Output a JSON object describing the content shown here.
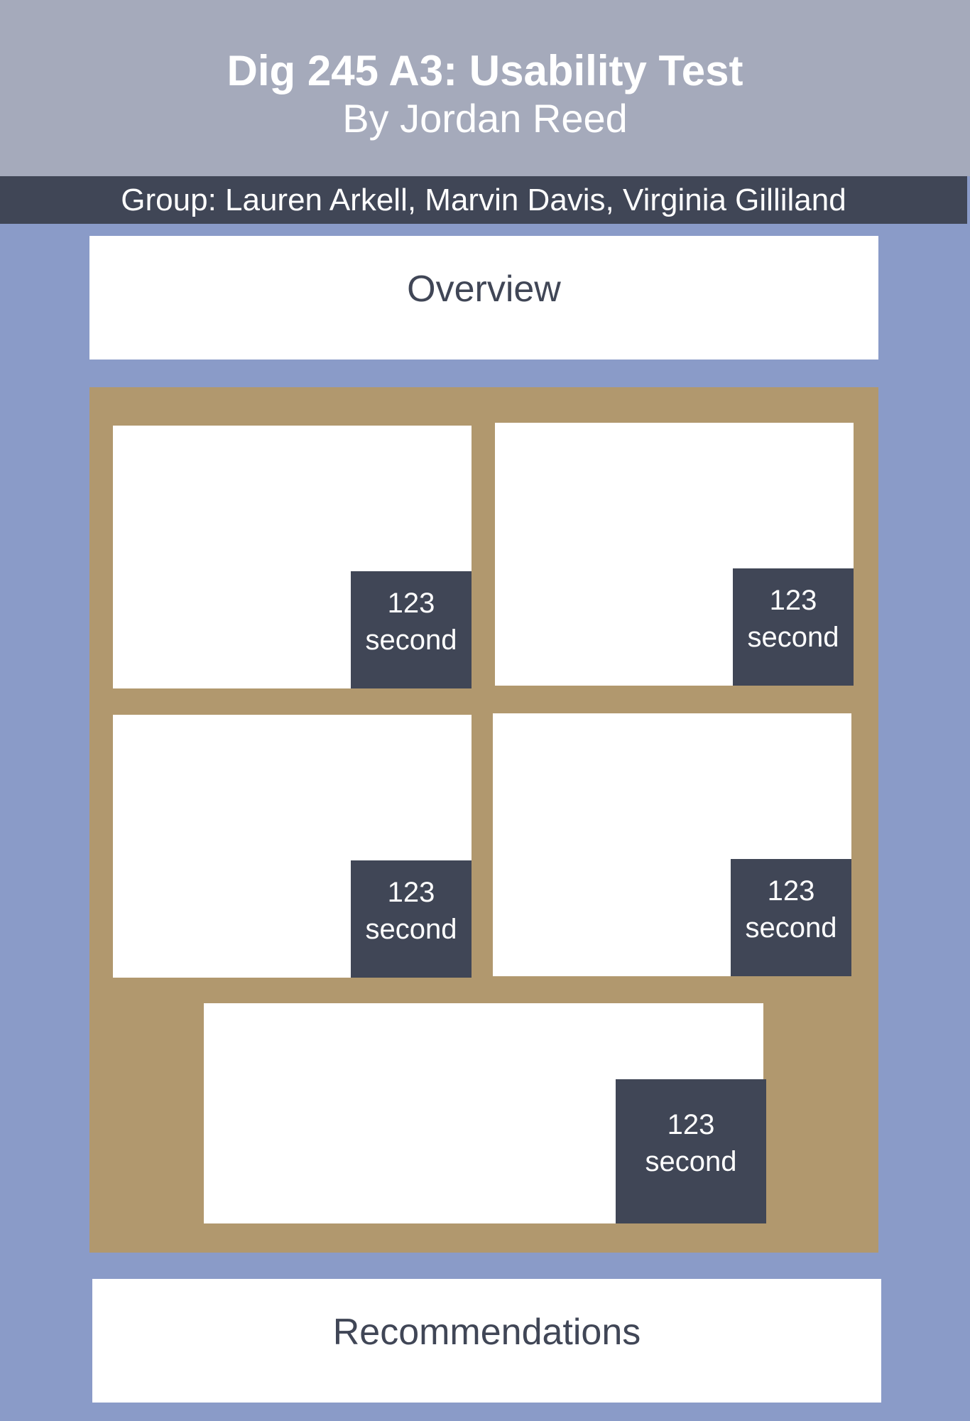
{
  "header": {
    "title": "Dig 245 A3: Usability Test",
    "subtitle": "By Jordan Reed"
  },
  "group_bar": {
    "text": "Group: Lauren Arkell, Marvin Davis, Virginia Gilliland"
  },
  "sections": {
    "overview": "Overview",
    "recommendations": "Recommendations"
  },
  "cards": [
    {
      "number": "123",
      "unit": "second"
    },
    {
      "number": "123",
      "unit": "second"
    },
    {
      "number": "123",
      "unit": "second"
    },
    {
      "number": "123",
      "unit": "second"
    },
    {
      "number": "123",
      "unit": "second"
    }
  ],
  "colors": {
    "page_background": "#8a9bc8",
    "header_background": "#a5aabb",
    "dark_bar": "#404656",
    "grid_panel": "#b1986e",
    "card": "#ffffff"
  }
}
